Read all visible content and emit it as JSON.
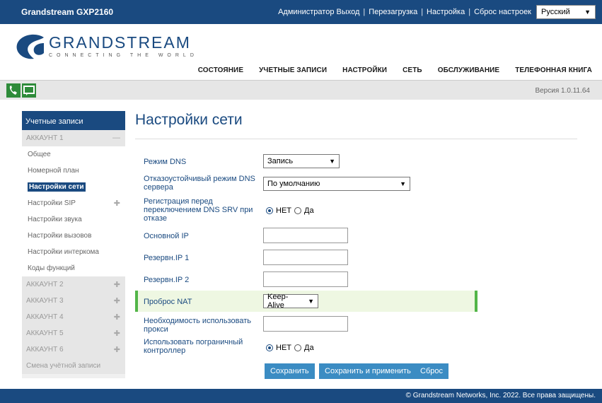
{
  "topbar": {
    "model": "Grandstream GXP2160",
    "links": [
      "Администратор Выход",
      "Перезагрузка",
      "Настройка",
      "Сброс настроек"
    ],
    "language": "Русский"
  },
  "logo": {
    "name": "GRANDSTREAM",
    "tagline": "CONNECTING THE WORLD"
  },
  "nav": [
    "СОСТОЯНИЕ",
    "УЧЕТНЫЕ ЗАПИСИ",
    "НАСТРОЙКИ",
    "СЕТЬ",
    "ОБСЛУЖИВАНИЕ",
    "ТЕЛЕФОННАЯ КНИГА"
  ],
  "version": "Версия 1.0.11.64",
  "sidebar": {
    "title": "Учетные записи",
    "account1": "АККАУНТ 1",
    "subitems": [
      "Общее",
      "Номерной план",
      "Настройки сети",
      "Настройки SIP",
      "Настройки звука",
      "Настройки вызовов",
      "Настройки интеркома",
      "Коды функций"
    ],
    "accounts": [
      "АККАУНТ 2",
      "АККАУНТ 3",
      "АККАУНТ 4",
      "АККАУНТ 5",
      "АККАУНТ 6"
    ],
    "switch": "Смена учётной записи"
  },
  "page": {
    "title": "Настройки сети",
    "dns_mode_label": "Режим DNS",
    "dns_mode_value": "Запись",
    "failover_label": "Отказоустойчивый режим DNS сервера",
    "failover_value": "По умолчанию",
    "register_label": "Регистрация перед переключением DNS SRV при отказе",
    "no": "НЕТ",
    "yes": "Да",
    "primary_ip_label": "Основной IP",
    "backup1_label": "Резервн.IP 1",
    "backup2_label": "Резервн.IP 2",
    "nat_label": "Проброс NAT",
    "nat_value": "Keep-Alive",
    "proxy_label": "Необходимость использовать прокси",
    "sbc_label": "Использовать пограничный контроллер",
    "save": "Сохранить",
    "save_apply": "Сохранить и применить",
    "reset": "Сброс"
  },
  "footer": "© Grandstream Networks, Inc. 2022. Все права защищены."
}
